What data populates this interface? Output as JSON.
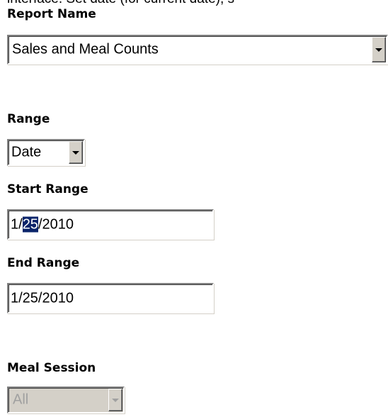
{
  "clipped_header_text": "interface. Set date (for current date), s",
  "report_name": {
    "label": "Report Name",
    "selected": "Sales and Meal Counts"
  },
  "range": {
    "label": "Range",
    "selected": "Date"
  },
  "start_range": {
    "label": "Start Range",
    "value_before_selection": "1/",
    "value_selected": "25",
    "value_after_selection": "/2010"
  },
  "end_range": {
    "label": "End Range",
    "value": "1/25/2010"
  },
  "meal_session": {
    "label": "Meal Session",
    "selected": "All",
    "disabled": true
  }
}
